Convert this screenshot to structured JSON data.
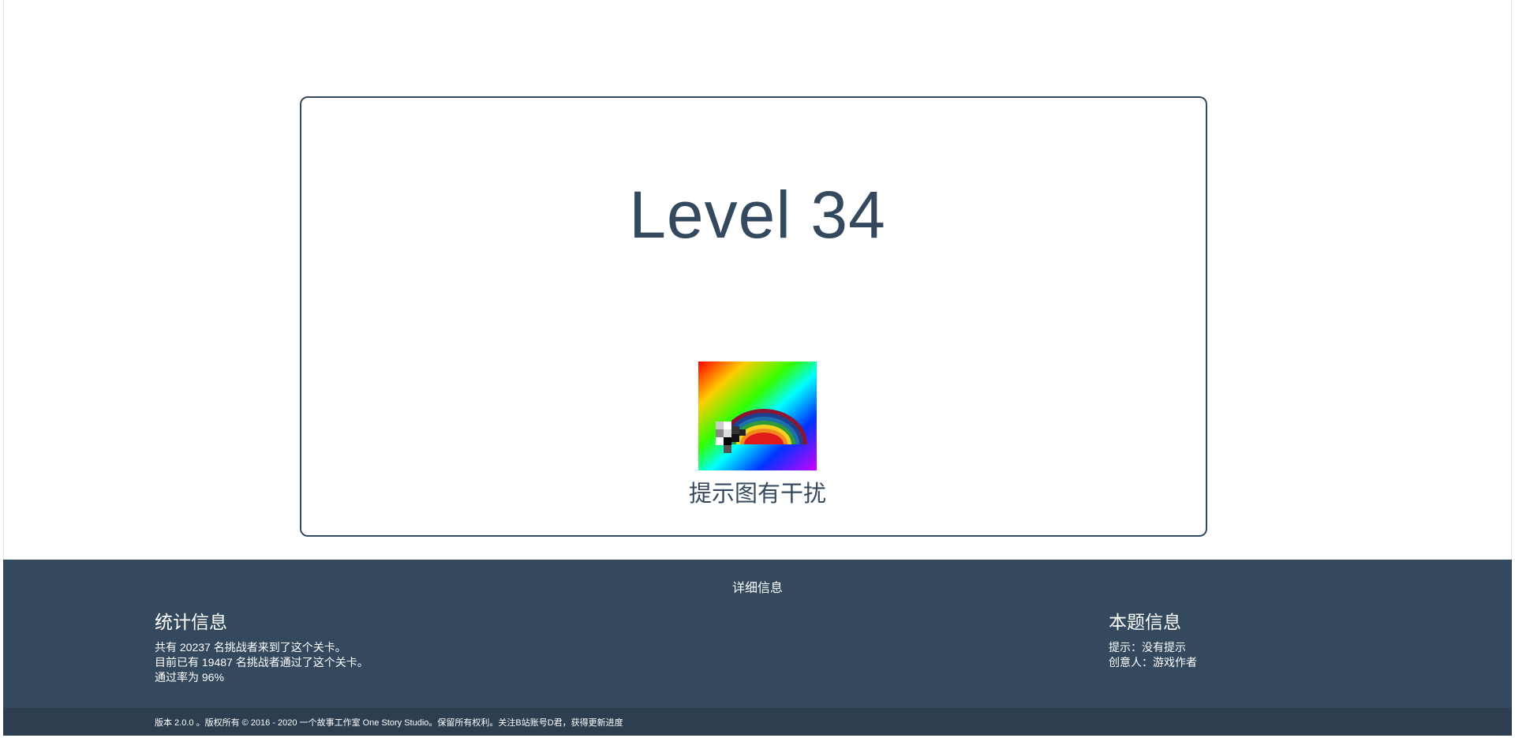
{
  "level": {
    "title": "Level 34",
    "hint_caption": "提示图有干扰"
  },
  "footer": {
    "heading": "详细信息",
    "stats": {
      "title": "统计信息",
      "lines": [
        "共有 20237 名挑战者来到了这个关卡。",
        "目前已有 19487 名挑战者通过了这个关卡。",
        "通过率为 96%"
      ]
    },
    "info": {
      "title": "本题信息",
      "lines": [
        "提示：没有提示",
        "创意人：游戏作者"
      ]
    },
    "copyright": "版本 2.0.0 。版权所有 © 2016 - 2020 一个故事工作室 One Story Studio。保留所有权利。关注B站账号D君，获得更新进度"
  },
  "colors": {
    "primary": "#34495e",
    "footer_bottom": "#2c3e50",
    "background": "#ffffff"
  }
}
